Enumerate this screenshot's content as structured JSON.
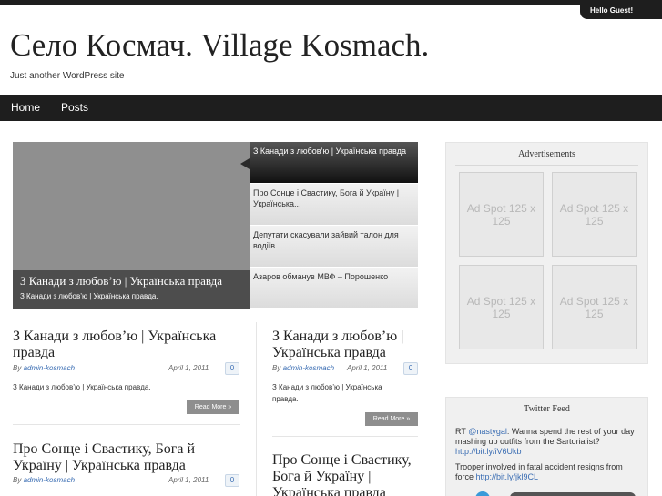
{
  "header": {
    "greeting": "Hello Guest!",
    "site_title": "Село Космач. Village Kosmach.",
    "tagline": "Just another WordPress site"
  },
  "nav": {
    "items": [
      "Home",
      "Posts"
    ]
  },
  "slider": {
    "caption_title": "З Канади з любов’ю | Українська правда",
    "caption_sub": "З Канади з любов’ю | Українська правда.",
    "tabs": [
      "З Канади з любов’ю | Українська правда",
      "Про Сонце і Свастику, Бога й Україну | Українська...",
      "Депутати скасували зайвий талон для водіїв",
      "Азаров обманув МВФ – Порошенко"
    ]
  },
  "posts": {
    "by_label": "By",
    "author": "admin-kosmach",
    "read_more": "Read More »",
    "left": [
      {
        "title": "З Канади з любов’ю | Українська правда",
        "date": "April 1, 2011",
        "comments": "0",
        "excerpt": "З Канади з любов’ю | Українська правда."
      },
      {
        "title": "Про Сонце і Свастику, Бога й Україну | Українська правда",
        "date": "April 1, 2011",
        "comments": "0"
      }
    ],
    "right": [
      {
        "title": "З Канади з любов’ю | Українська правда",
        "date": "April 1, 2011",
        "comments": "0",
        "excerpt": "З Канади з любов’ю | Українська правда."
      },
      {
        "title": "Про Сонце і Свастику, Бога й Україну | Українська правда"
      }
    ]
  },
  "sidebar": {
    "ads_title": "Advertisements",
    "ads": [
      "Ad Spot 125 x 125",
      "Ad Spot 125 x 125",
      "Ad Spot 125 x 125",
      "Ad Spot 125 x 125"
    ],
    "twitter_title": "Twitter Feed",
    "tweets": [
      {
        "prefix": "RT ",
        "mention": "@nastygal",
        "text": ": Wanna spend the rest of your day mashing up outfits from the Sartorialist?",
        "link": "http://bit.ly/iV6Ukb"
      },
      {
        "prefix": "",
        "mention": "",
        "text": "Trooper involved in fatal accident resigns from force",
        "link": "http://bit.ly/jkl9CL"
      }
    ]
  },
  "colors": {
    "dark_bar": "#1e1e1e",
    "link": "#3a6db3",
    "slider_bg": "#8f8f8f"
  },
  "icons": [
    "twitter-bird-icon"
  ]
}
